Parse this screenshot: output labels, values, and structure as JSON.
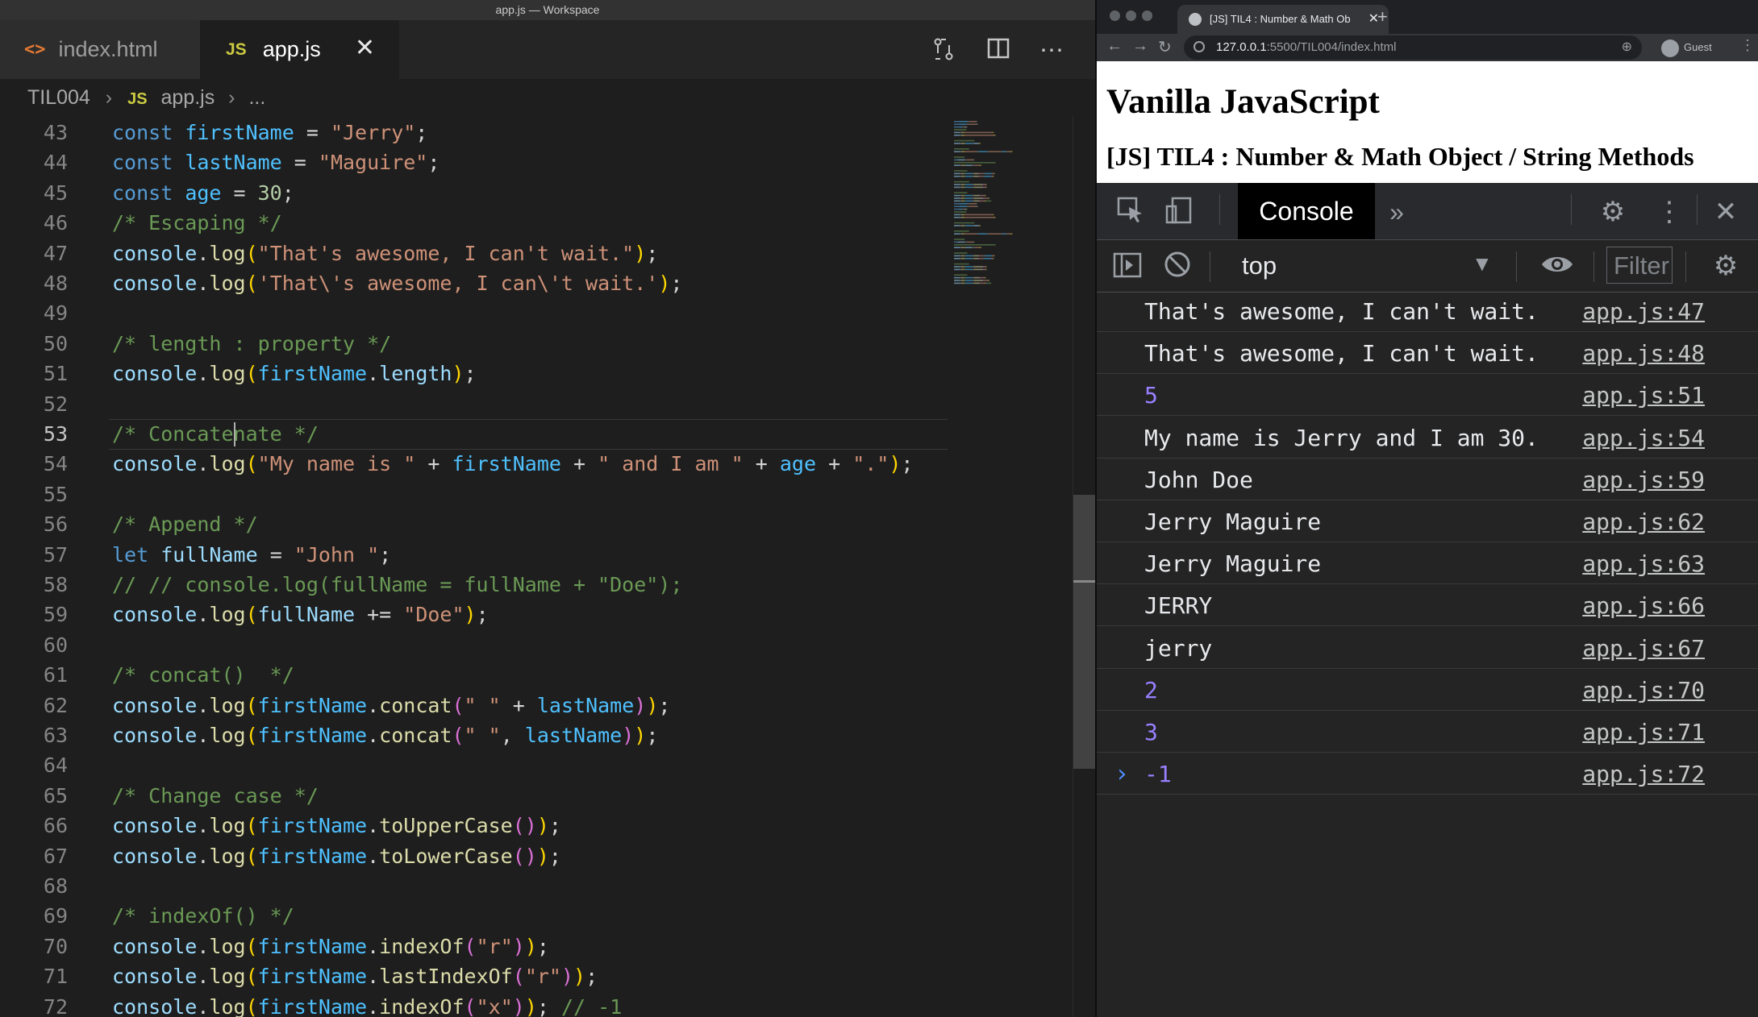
{
  "editor": {
    "window_title": "app.js — Workspace",
    "tabs": [
      {
        "icon": "html-file-icon",
        "label": "index.html"
      },
      {
        "icon": "js-file-icon",
        "icon_text": "JS",
        "label": "app.js"
      }
    ],
    "breadcrumb": {
      "folder": "TIL004",
      "file_icon": "JS",
      "file": "app.js",
      "more": "..."
    },
    "active_line": "53",
    "lines": [
      {
        "n": "43",
        "tokens": [
          [
            "kw",
            "const "
          ],
          [
            "var",
            "firstName"
          ],
          [
            "punc",
            " = "
          ],
          [
            "str",
            "\"Jerry\""
          ],
          [
            "punc",
            ";"
          ]
        ]
      },
      {
        "n": "44",
        "tokens": [
          [
            "kw",
            "const "
          ],
          [
            "var",
            "lastName"
          ],
          [
            "punc",
            " = "
          ],
          [
            "str",
            "\"Maguire\""
          ],
          [
            "punc",
            ";"
          ]
        ]
      },
      {
        "n": "45",
        "tokens": [
          [
            "kw",
            "const "
          ],
          [
            "var",
            "age"
          ],
          [
            "punc",
            " = "
          ],
          [
            "num",
            "30"
          ],
          [
            "punc",
            ";"
          ]
        ]
      },
      {
        "n": "46",
        "tokens": [
          [
            "cm",
            "/* Escaping */"
          ]
        ]
      },
      {
        "n": "47",
        "tokens": [
          [
            "ident",
            "console"
          ],
          [
            "punc",
            "."
          ],
          [
            "fn",
            "log"
          ],
          [
            "br1",
            "("
          ],
          [
            "str",
            "\"That's awesome, I can't wait.\""
          ],
          [
            "br1",
            ")"
          ],
          [
            "punc",
            ";"
          ]
        ]
      },
      {
        "n": "48",
        "tokens": [
          [
            "ident",
            "console"
          ],
          [
            "punc",
            "."
          ],
          [
            "fn",
            "log"
          ],
          [
            "br1",
            "("
          ],
          [
            "str",
            "'That\\'s awesome, I can\\'t wait.'"
          ],
          [
            "br1",
            ")"
          ],
          [
            "punc",
            ";"
          ]
        ]
      },
      {
        "n": "49",
        "tokens": []
      },
      {
        "n": "50",
        "tokens": [
          [
            "cm",
            "/* length : property */"
          ]
        ]
      },
      {
        "n": "51",
        "tokens": [
          [
            "ident",
            "console"
          ],
          [
            "punc",
            "."
          ],
          [
            "fn",
            "log"
          ],
          [
            "br1",
            "("
          ],
          [
            "var",
            "firstName"
          ],
          [
            "punc",
            "."
          ],
          [
            "prop",
            "length"
          ],
          [
            "br1",
            ")"
          ],
          [
            "punc",
            ";"
          ]
        ]
      },
      {
        "n": "52",
        "tokens": []
      },
      {
        "n": "53",
        "tokens": [
          [
            "cm",
            "/* Concatenate */"
          ]
        ]
      },
      {
        "n": "54",
        "tokens": [
          [
            "ident",
            "console"
          ],
          [
            "punc",
            "."
          ],
          [
            "fn",
            "log"
          ],
          [
            "br1",
            "("
          ],
          [
            "str",
            "\"My name is \""
          ],
          [
            "punc",
            " + "
          ],
          [
            "var",
            "firstName"
          ],
          [
            "punc",
            " + "
          ],
          [
            "str",
            "\" and I am \""
          ],
          [
            "punc",
            " + "
          ],
          [
            "var",
            "age"
          ],
          [
            "punc",
            " + "
          ],
          [
            "str",
            "\".\""
          ],
          [
            "br1",
            ")"
          ],
          [
            "punc",
            ";"
          ]
        ]
      },
      {
        "n": "55",
        "tokens": []
      },
      {
        "n": "56",
        "tokens": [
          [
            "cm",
            "/* Append */"
          ]
        ]
      },
      {
        "n": "57",
        "tokens": [
          [
            "kw",
            "let "
          ],
          [
            "ident",
            "fullName"
          ],
          [
            "punc",
            " = "
          ],
          [
            "str",
            "\"John \""
          ],
          [
            "punc",
            ";"
          ]
        ]
      },
      {
        "n": "58",
        "tokens": [
          [
            "cm",
            "// // console.log(fullName = fullName + \"Doe\");"
          ]
        ]
      },
      {
        "n": "59",
        "tokens": [
          [
            "ident",
            "console"
          ],
          [
            "punc",
            "."
          ],
          [
            "fn",
            "log"
          ],
          [
            "br1",
            "("
          ],
          [
            "ident",
            "fullName"
          ],
          [
            "punc",
            " += "
          ],
          [
            "str",
            "\"Doe\""
          ],
          [
            "br1",
            ")"
          ],
          [
            "punc",
            ";"
          ]
        ]
      },
      {
        "n": "60",
        "tokens": []
      },
      {
        "n": "61",
        "tokens": [
          [
            "cm",
            "/* concat()  */"
          ]
        ]
      },
      {
        "n": "62",
        "tokens": [
          [
            "ident",
            "console"
          ],
          [
            "punc",
            "."
          ],
          [
            "fn",
            "log"
          ],
          [
            "br1",
            "("
          ],
          [
            "var",
            "firstName"
          ],
          [
            "punc",
            "."
          ],
          [
            "fn",
            "concat"
          ],
          [
            "br2",
            "("
          ],
          [
            "str",
            "\" \""
          ],
          [
            "punc",
            " + "
          ],
          [
            "var",
            "lastName"
          ],
          [
            "br2",
            ")"
          ],
          [
            "br1",
            ")"
          ],
          [
            "punc",
            ";"
          ]
        ]
      },
      {
        "n": "63",
        "tokens": [
          [
            "ident",
            "console"
          ],
          [
            "punc",
            "."
          ],
          [
            "fn",
            "log"
          ],
          [
            "br1",
            "("
          ],
          [
            "var",
            "firstName"
          ],
          [
            "punc",
            "."
          ],
          [
            "fn",
            "concat"
          ],
          [
            "br2",
            "("
          ],
          [
            "str",
            "\" \""
          ],
          [
            "punc",
            ", "
          ],
          [
            "var",
            "lastName"
          ],
          [
            "br2",
            ")"
          ],
          [
            "br1",
            ")"
          ],
          [
            "punc",
            ";"
          ]
        ]
      },
      {
        "n": "64",
        "tokens": []
      },
      {
        "n": "65",
        "tokens": [
          [
            "cm",
            "/* Change case */"
          ]
        ]
      },
      {
        "n": "66",
        "tokens": [
          [
            "ident",
            "console"
          ],
          [
            "punc",
            "."
          ],
          [
            "fn",
            "log"
          ],
          [
            "br1",
            "("
          ],
          [
            "var",
            "firstName"
          ],
          [
            "punc",
            "."
          ],
          [
            "fn",
            "toUpperCase"
          ],
          [
            "br2",
            "()"
          ],
          [
            "br1",
            ")"
          ],
          [
            "punc",
            ";"
          ]
        ]
      },
      {
        "n": "67",
        "tokens": [
          [
            "ident",
            "console"
          ],
          [
            "punc",
            "."
          ],
          [
            "fn",
            "log"
          ],
          [
            "br1",
            "("
          ],
          [
            "var",
            "firstName"
          ],
          [
            "punc",
            "."
          ],
          [
            "fn",
            "toLowerCase"
          ],
          [
            "br2",
            "()"
          ],
          [
            "br1",
            ")"
          ],
          [
            "punc",
            ";"
          ]
        ]
      },
      {
        "n": "68",
        "tokens": []
      },
      {
        "n": "69",
        "tokens": [
          [
            "cm",
            "/* indexOf() */"
          ]
        ]
      },
      {
        "n": "70",
        "tokens": [
          [
            "ident",
            "console"
          ],
          [
            "punc",
            "."
          ],
          [
            "fn",
            "log"
          ],
          [
            "br1",
            "("
          ],
          [
            "var",
            "firstName"
          ],
          [
            "punc",
            "."
          ],
          [
            "fn",
            "indexOf"
          ],
          [
            "br2",
            "("
          ],
          [
            "str",
            "\"r\""
          ],
          [
            "br2",
            ")"
          ],
          [
            "br1",
            ")"
          ],
          [
            "punc",
            ";"
          ]
        ]
      },
      {
        "n": "71",
        "tokens": [
          [
            "ident",
            "console"
          ],
          [
            "punc",
            "."
          ],
          [
            "fn",
            "log"
          ],
          [
            "br1",
            "("
          ],
          [
            "var",
            "firstName"
          ],
          [
            "punc",
            "."
          ],
          [
            "fn",
            "lastIndexOf"
          ],
          [
            "br2",
            "("
          ],
          [
            "str",
            "\"r\""
          ],
          [
            "br2",
            ")"
          ],
          [
            "br1",
            ")"
          ],
          [
            "punc",
            ";"
          ]
        ]
      },
      {
        "n": "72",
        "tokens": [
          [
            "ident",
            "console"
          ],
          [
            "punc",
            "."
          ],
          [
            "fn",
            "log"
          ],
          [
            "br1",
            "("
          ],
          [
            "var",
            "firstName"
          ],
          [
            "punc",
            "."
          ],
          [
            "fn",
            "indexOf"
          ],
          [
            "br2",
            "("
          ],
          [
            "str",
            "\"x\""
          ],
          [
            "br2",
            ")"
          ],
          [
            "br1",
            ")"
          ],
          [
            "punc",
            "; "
          ],
          [
            "cm",
            "// -1"
          ]
        ]
      }
    ]
  },
  "browser": {
    "tab_title": "[JS] TIL4 : Number & Math Ob",
    "url_host": "127.0.0.1",
    "url_path": ":5500/TIL004/index.html",
    "profile": "Guest",
    "page": {
      "heading": "Vanilla JavaScript",
      "subheading": "[JS] TIL4 : Number & Math Object / String Methods"
    },
    "devtools": {
      "active_tab": "Console",
      "more_tabs": "»",
      "context": "top",
      "filter_placeholder": "Filter",
      "messages": [
        {
          "text": "That's awesome, I can't wait.",
          "source": "app.js:47",
          "type": "string"
        },
        {
          "text": "That's awesome, I can't wait.",
          "source": "app.js:48",
          "type": "string"
        },
        {
          "text": "5",
          "source": "app.js:51",
          "type": "number"
        },
        {
          "text": "My name is Jerry and I am 30.",
          "source": "app.js:54",
          "type": "string"
        },
        {
          "text": "John Doe",
          "source": "app.js:59",
          "type": "string"
        },
        {
          "text": "Jerry Maguire",
          "source": "app.js:62",
          "type": "string"
        },
        {
          "text": "Jerry Maguire",
          "source": "app.js:63",
          "type": "string"
        },
        {
          "text": "JERRY",
          "source": "app.js:66",
          "type": "string"
        },
        {
          "text": "jerry",
          "source": "app.js:67",
          "type": "string"
        },
        {
          "text": "2",
          "source": "app.js:70",
          "type": "number"
        },
        {
          "text": "3",
          "source": "app.js:71",
          "type": "number"
        },
        {
          "text": "-1",
          "source": "app.js:72",
          "type": "number"
        }
      ],
      "prompt": "›"
    }
  }
}
